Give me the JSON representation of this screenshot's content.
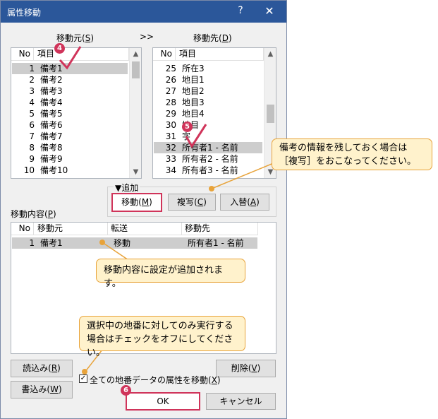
{
  "window": {
    "title": "属性移動",
    "help": "?",
    "close": "✕"
  },
  "source": {
    "label": "移動元(",
    "mnemonic": "S",
    "label_end": ")",
    "col_no": "No",
    "col_item": "項目",
    "rows": [
      {
        "no": "1",
        "name": "備考1"
      },
      {
        "no": "2",
        "name": "備考2"
      },
      {
        "no": "3",
        "name": "備考3"
      },
      {
        "no": "4",
        "name": "備考4"
      },
      {
        "no": "5",
        "name": "備考5"
      },
      {
        "no": "6",
        "name": "備考6"
      },
      {
        "no": "7",
        "name": "備考7"
      },
      {
        "no": "8",
        "name": "備考8"
      },
      {
        "no": "9",
        "name": "備考9"
      },
      {
        "no": "10",
        "name": "備考10"
      }
    ]
  },
  "arrow_label": ">>",
  "dest": {
    "label": "移動先(",
    "mnemonic": "D",
    "label_end": ")",
    "col_no": "No",
    "col_item": "項目",
    "rows": [
      {
        "no": "25",
        "name": "所在3"
      },
      {
        "no": "26",
        "name": "地目1"
      },
      {
        "no": "27",
        "name": "地目2"
      },
      {
        "no": "28",
        "name": "地目3"
      },
      {
        "no": "29",
        "name": "地目4"
      },
      {
        "no": "30",
        "name": "地目"
      },
      {
        "no": "31",
        "name": "字"
      },
      {
        "no": "32",
        "name": "所有者1 - 名前"
      },
      {
        "no": "33",
        "name": "所有者2 - 名前"
      },
      {
        "no": "34",
        "name": "所有者3 - 名前"
      }
    ]
  },
  "add_group": {
    "label": "▼追加",
    "move": {
      "text": "移動(",
      "mn": "M",
      "end": ")"
    },
    "copy": {
      "text": "複写(",
      "mn": "C",
      "end": ")"
    },
    "swap": {
      "text": "入替(",
      "mn": "A",
      "end": ")"
    }
  },
  "content": {
    "label": "移動内容(",
    "mnemonic": "P",
    "label_end": ")",
    "col_no": "No",
    "col_src": "移動元",
    "col_op": "転送",
    "col_dst": "移動先",
    "rows": [
      {
        "no": "1",
        "src": "備考1",
        "op": "移動",
        "dst": "所有者1 - 名前"
      }
    ]
  },
  "buttons": {
    "read": {
      "text": "読込み(",
      "mn": "R",
      "end": ")"
    },
    "write": {
      "text": "書込み(",
      "mn": "W",
      "end": ")"
    },
    "delete": {
      "text": "削除(",
      "mn": "V",
      "end": ")"
    },
    "ok": "OK",
    "cancel": "キャンセル"
  },
  "checkbox": {
    "text": "全ての地番データの属性を移動(",
    "mn": "X",
    "end": ")",
    "checked": true
  },
  "callouts": {
    "copy_note": "備考の情報を残しておく場合は［複写］をおこなってください。",
    "added_note": "移動内容に設定が追加されます。",
    "check_note_1": "選択中の地番に対してのみ実行する",
    "check_note_2": "場合はチェックをオフにしてください。"
  },
  "badges": {
    "b4": "4",
    "b5": "5",
    "b6": "6"
  },
  "colors": {
    "accent": "#d0345a",
    "callout_bg": "#fff2cc",
    "callout_border": "#e8a33a",
    "titlebar": "#2b579a"
  }
}
